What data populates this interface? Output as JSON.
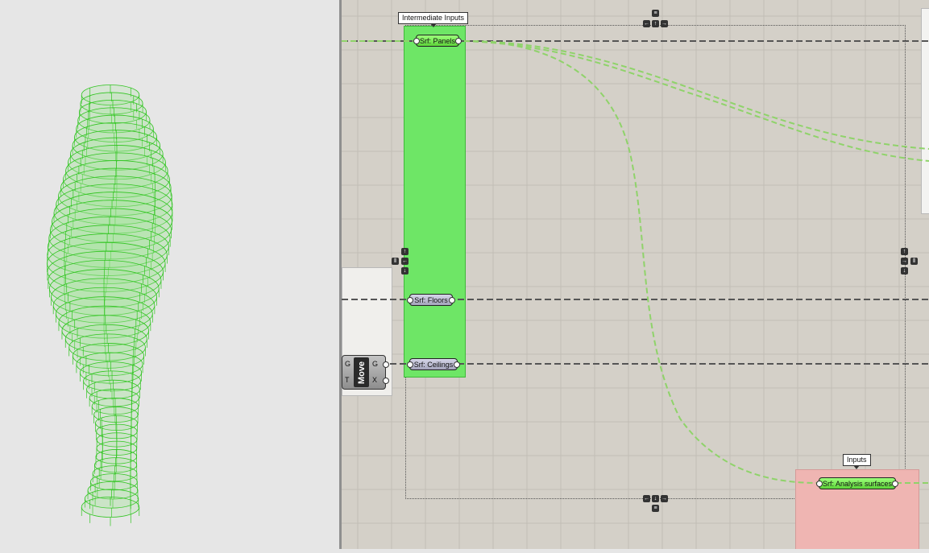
{
  "viewport": {
    "name": "3d-viewport"
  },
  "canvas": {
    "groups": {
      "intermediate_label": "Intermediate Inputs",
      "inputs_label": "Inputs"
    },
    "components": {
      "panels": "Srf: Panels",
      "floors": "Srf: Floors",
      "ceilings": "Srf: Ceilings",
      "analysis": "Srf: Analysis surfaces"
    },
    "move": {
      "title": "Move",
      "in_g": "G",
      "in_t": "T",
      "out_g": "G",
      "out_x": "X"
    }
  },
  "colors": {
    "canvas_bg": "#d4d0c8",
    "grid": "#c2beb6",
    "green_group": "#5ee64f",
    "red_group": "#f2a8a8",
    "wire_green": "#8fd36a",
    "wire_black": "#555555",
    "mesh": "#2fc41f"
  }
}
